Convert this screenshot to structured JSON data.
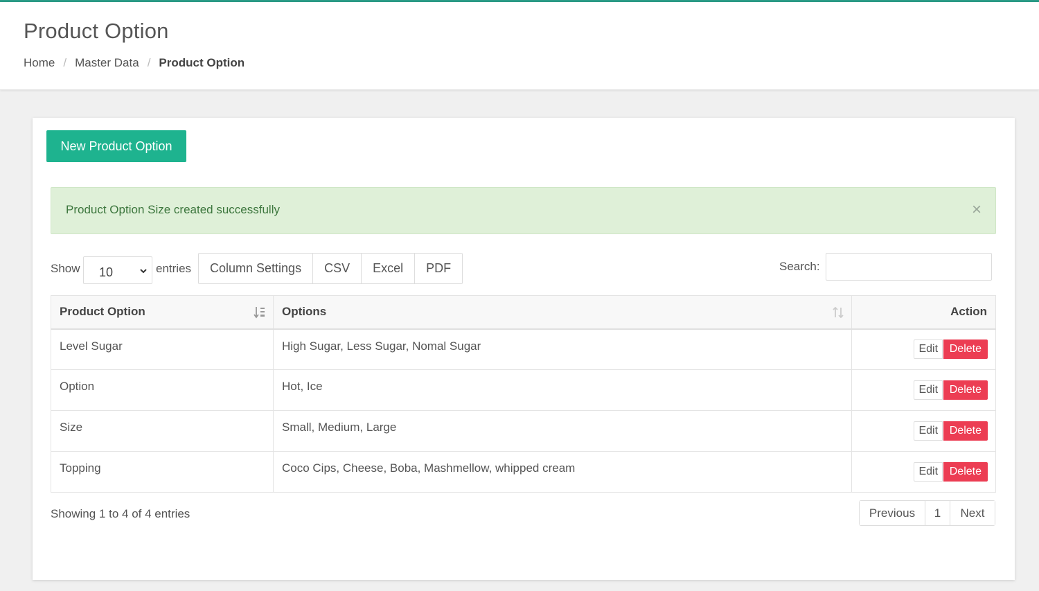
{
  "header": {
    "title": "Product Option",
    "breadcrumb": [
      {
        "label": "Home"
      },
      {
        "label": "Master Data"
      },
      {
        "label": "Product Option"
      }
    ],
    "breadcrumb_sep": "/"
  },
  "toolbar": {
    "new_label": "New Product Option"
  },
  "alert": {
    "message": "Product Option Size created successfully",
    "close_icon": "×"
  },
  "controls": {
    "show_label": "Show",
    "page_size": "10",
    "entries_label": "entries",
    "buttons": [
      "Column Settings",
      "CSV",
      "Excel",
      "PDF"
    ],
    "search_label": "Search:",
    "search_value": ""
  },
  "table": {
    "columns": [
      "Product Option",
      "Options",
      "Action"
    ],
    "rows": [
      {
        "product_option": "Level Sugar",
        "options": "High Sugar, Less Sugar, Nomal Sugar"
      },
      {
        "product_option": "Option",
        "options": "Hot, Ice"
      },
      {
        "product_option": "Size",
        "options": "Small, Medium, Large"
      },
      {
        "product_option": "Topping",
        "options": "Coco Cips, Cheese, Boba, Mashmellow, whipped cream"
      }
    ],
    "edit_label": "Edit",
    "delete_label": "Delete"
  },
  "footer": {
    "info": "Showing 1 to 4 of 4 entries",
    "prev_label": "Previous",
    "page": "1",
    "next_label": "Next"
  },
  "colors": {
    "primary": "#1eb38f",
    "danger": "#ec3d53",
    "success_bg": "#dff0d8",
    "success_text": "#3c763d",
    "topbar": "#2b9b87"
  }
}
